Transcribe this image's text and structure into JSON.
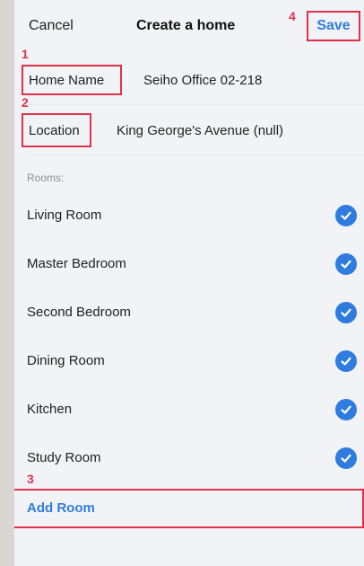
{
  "nav": {
    "cancel_label": "Cancel",
    "title": "Create a home",
    "save_label": "Save"
  },
  "annotations": {
    "n1": "1",
    "n2": "2",
    "n3": "3",
    "n4": "4"
  },
  "form": {
    "home_name_label": "Home Name",
    "home_name_value": "Seiho Office 02-218",
    "location_label": "Location",
    "location_value": "King George's Avenue (null)"
  },
  "rooms": {
    "section_title": "Rooms:",
    "items": [
      {
        "label": "Living Room",
        "checked": true
      },
      {
        "label": "Master Bedroom",
        "checked": true
      },
      {
        "label": "Second Bedroom",
        "checked": true
      },
      {
        "label": "Dining Room",
        "checked": true
      },
      {
        "label": "Kitchen",
        "checked": true
      },
      {
        "label": "Study Room",
        "checked": true
      }
    ],
    "add_label": "Add Room"
  },
  "colors": {
    "accent": "#2f7ce0",
    "annotation": "#e0314b",
    "background": "#f2f3f6"
  }
}
